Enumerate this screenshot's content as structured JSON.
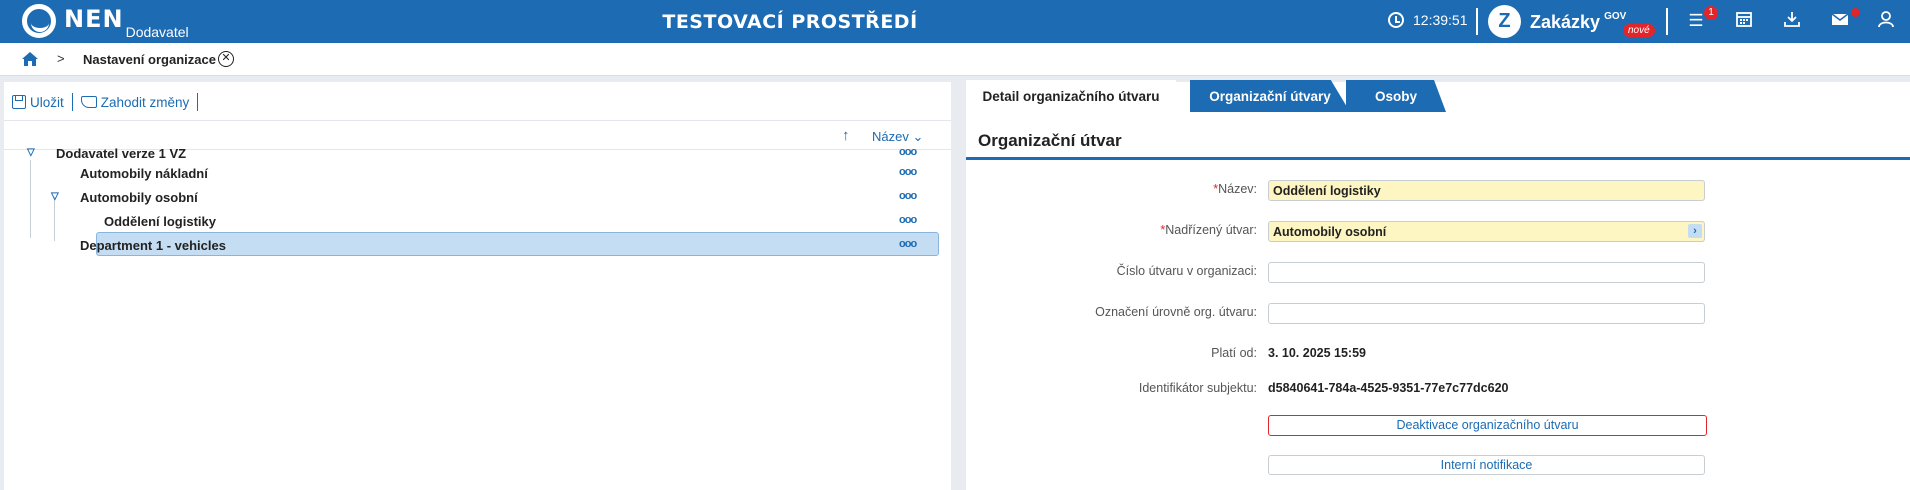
{
  "header": {
    "logo_text": "NEN",
    "logo_sub": "Dodavatel",
    "env_title": "TESTOVACÍ PROSTŘEDÍ",
    "clock": "12:39:51",
    "zakazky_label": "Zakázky",
    "zakazky_gov": "GOV",
    "zakazky_new": "nové",
    "menu_badge": "1"
  },
  "breadcrumb": {
    "title": "Nastavení organizace"
  },
  "toolbar": {
    "save_label": "Uložit",
    "discard_label": "Zahodit změny"
  },
  "sort": {
    "field_label": "Název"
  },
  "tree": {
    "items": [
      {
        "label": "Dodavatel verze 1 VZ",
        "level": 0,
        "expanded": true
      },
      {
        "label": "Automobily nákladní",
        "level": 1,
        "expanded": null
      },
      {
        "label": "Automobily osobní",
        "level": 1,
        "expanded": true
      },
      {
        "label": "Oddělení logistiky",
        "level": 2,
        "expanded": null,
        "selected": true
      },
      {
        "label": "Department 1 - vehicles",
        "level": 1,
        "expanded": null
      }
    ]
  },
  "tabs": [
    {
      "label": "Detail organizačního útvaru",
      "active": true
    },
    {
      "label": "Organizační útvary",
      "active": false
    },
    {
      "label": "Osoby",
      "active": false
    }
  ],
  "detail": {
    "section_title": "Organizační útvar",
    "name_label": "Název:",
    "name_value": "Oddělení logistiky",
    "parent_label": "Nadřízený útvar:",
    "parent_value": "Automobily osobní",
    "unit_number_label": "Číslo útvaru v organizaci:",
    "unit_number_value": "",
    "level_mark_label": "Označení úrovně org. útvaru:",
    "level_mark_value": "",
    "valid_from_label": "Platí od:",
    "valid_from_value": "3. 10. 2025 15:59",
    "subject_id_label": "Identifikátor subjektu:",
    "subject_id_value": "d5840641-784a-4525-9351-77e7c77dc620",
    "deactivate_label": "Deaktivace organizačního útvaru",
    "notifications_label": "Interní notifikace"
  },
  "colors": {
    "primary": "#1c6bb3",
    "danger": "#e0262b",
    "required_bg": "#fdf5c2",
    "selected_bg": "#c5ddf3"
  }
}
